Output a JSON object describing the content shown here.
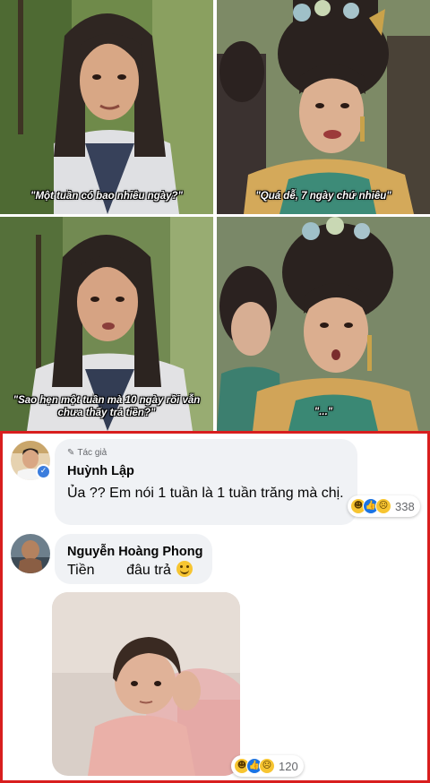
{
  "meme": {
    "panels": [
      {
        "caption": "\"Một tuần có bao nhiêu ngày?\""
      },
      {
        "caption": "\"Quá dễ, 7 ngày chứ nhiêu\""
      },
      {
        "caption_line1": "\"Sao hẹn một tuần mà 10 ngày rồi vẫn",
        "caption_line2": "chưa thấy trả tiền?\""
      },
      {
        "caption": "\"...\""
      }
    ]
  },
  "comments": [
    {
      "author_tag": "Tác giả",
      "author_tag_icon": "pencil-icon",
      "name": "Huỳnh Lập",
      "verified": true,
      "text": "Ủa ?? Em nói 1 tuần là 1 tuần trăng mà chị.",
      "reactions": [
        "haha",
        "like",
        "sad"
      ],
      "reaction_count": "338"
    },
    {
      "name": "Nguyễn Hoàng Phong",
      "text": "Tiền        đâu trả",
      "emoji": "smiling-face-icon",
      "attachment": "photo-of-toddler",
      "reactions": [
        "haha",
        "like",
        "sad"
      ],
      "reaction_count": "120"
    }
  ],
  "colors": {
    "frame_border": "#d81e1e",
    "bubble_bg": "#f0f2f5",
    "like_blue": "#1b74e4",
    "haha_yellow": "#f7c531",
    "meta_gray": "#65676b"
  }
}
